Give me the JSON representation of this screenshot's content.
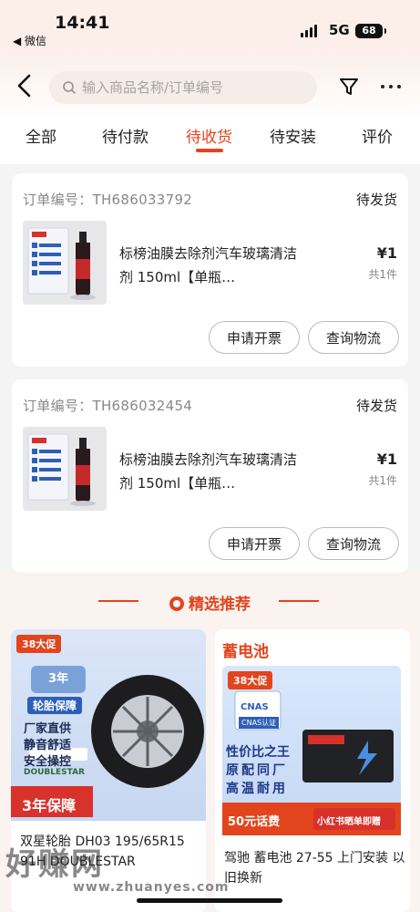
{
  "status_bar": {
    "time": "14:41",
    "back_app": "◀ 微信",
    "network": "5G",
    "battery": "68"
  },
  "header": {
    "search_placeholder": "输入商品名称/订单编号"
  },
  "tabs": [
    {
      "label": "全部"
    },
    {
      "label": "待付款"
    },
    {
      "label": "待收货",
      "active": true
    },
    {
      "label": "待安装"
    },
    {
      "label": "评价"
    }
  ],
  "orders": [
    {
      "order_no": "订单编号：TH686033792",
      "status": "待发货",
      "title": "标榜油膜去除剂汽车玻璃清洁剂 150ml【单瓶…",
      "price": "¥1",
      "qty": "共1件",
      "invoice_label": "申请开票",
      "logistics_label": "查询物流"
    },
    {
      "order_no": "订单编号：TH686032454",
      "status": "待发货",
      "title": "标榜油膜去除剂汽车玻璃清洁剂 150ml【单瓶…",
      "price": "¥1",
      "qty": "共1件",
      "invoice_label": "申请开票",
      "logistics_label": "查询物流"
    }
  ],
  "recommend": {
    "title": "精选推荐",
    "products": [
      {
        "tag": "38大促",
        "badge": "3年",
        "badge_sub": "轮胎保障",
        "features": [
          "厂家直供",
          "静音舒适",
          "安全操控"
        ],
        "brand": "DOUBLESTAR",
        "banner": "3年保障",
        "name": "双星轮胎 DH03 195/65R15 91H DOUBLESTAR"
      },
      {
        "category": "蓄电池",
        "tag": "38大促",
        "cert": "CNAS",
        "cert_sub": "CNAS认证",
        "slogan": [
          "性价比之王",
          "原配同厂",
          "高温耐用"
        ],
        "banner_left": "50元话费",
        "banner_right": "小红书晒单即赠",
        "name": "驾驰 蓄电池 27-55 上门安装 以旧换新"
      }
    ]
  },
  "watermark": {
    "text": "好赚网",
    "url": "www.zhuanyes.com"
  },
  "colors": {
    "accent": "#e2451e",
    "background": "#f4f4f4"
  }
}
